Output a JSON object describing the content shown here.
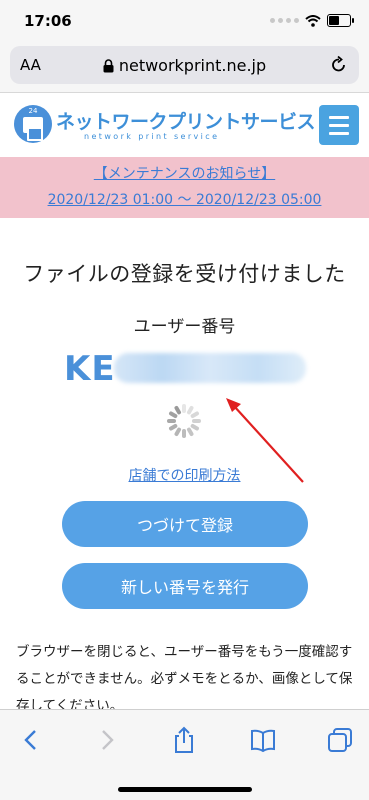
{
  "status_bar": {
    "time": "17:06"
  },
  "browser": {
    "aa_label": "AA",
    "url": "networkprint.ne.jp"
  },
  "site": {
    "logo_text": "ネットワークプリントサービス",
    "logo_subtitle": "network print service",
    "logo_badge": "24"
  },
  "notice": {
    "title": "【メンテナンスのお知らせ】",
    "period": "2020/12/23 01:00 ～ 2020/12/23 05:00"
  },
  "main": {
    "heading": "ファイルの登録を受け付けました",
    "user_number_label": "ユーザー番号",
    "user_number_prefix": "KE",
    "store_print_link": "店舗での印刷方法",
    "continue_button": "つづけて登録",
    "issue_button": "新しい番号を発行",
    "note": "ブラウザーを閉じると、ユーザー番号をもう一度確認することができません。必ずメモをとるか、画像として保存してください。"
  },
  "colors": {
    "accent": "#56a2e6",
    "notice_bg": "#f2c2cc",
    "link": "#3a7bd5",
    "annotation_arrow": "#e02020"
  }
}
